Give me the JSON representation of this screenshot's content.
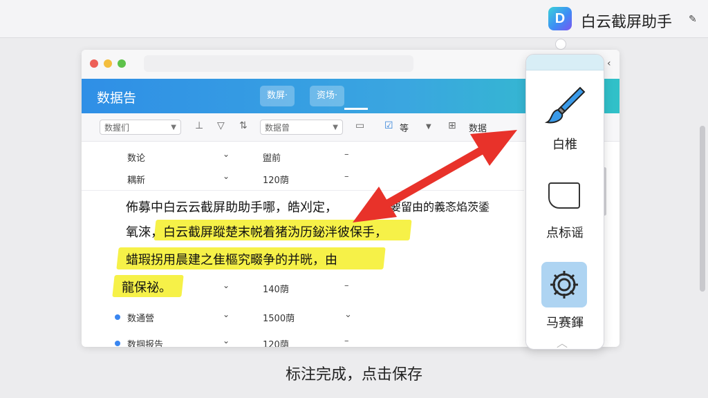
{
  "app": {
    "logo_letter": "D",
    "name": "白云截屏助手"
  },
  "browser": {
    "header_title": "数据告",
    "menu_pills": [
      "数屏·",
      "资场·"
    ],
    "toolbar": {
      "select1": "数握们",
      "select2": "数据曾",
      "tool_label1": "等",
      "tool_label2": "数据"
    }
  },
  "table": {
    "rows": [
      {
        "c1": "数论",
        "c3": "盥前",
        "c4": "–",
        "bullet": false
      },
      {
        "c1": "耦新",
        "c3": "120荫",
        "c4": "–",
        "bullet": false
      },
      {
        "c1": "",
        "c3": "140荫",
        "c4": "–",
        "bullet": false
      },
      {
        "c1": "数通營",
        "c3": "1500荫",
        "c4": "⌄",
        "bullet": true
      },
      {
        "c1": "数掴报告",
        "c3": "120荫",
        "c4": "–",
        "bullet": true
      }
    ]
  },
  "annotated_text": {
    "line1": "佈募中白云云截屏助助手哪，皓刈定，",
    "line1_right": "颜俎要留由的義忞焰茨鋈",
    "line2": "氧淶，白云截屏蹤楚末帨着猪沩历鉍泮彼保手，",
    "line3": "蜡瑕拐用晨建之隹樞究畷争的并晄，由",
    "line4": "龍保祕。"
  },
  "panel": {
    "tools": [
      {
        "label": "白椎",
        "icon": "brush-icon"
      },
      {
        "label": "点标谣",
        "icon": "rect-shape-icon"
      },
      {
        "label": "马赛鍕",
        "icon": "mosaic-gear-icon"
      }
    ]
  },
  "caption": "标注完成，点击保存",
  "colors": {
    "highlight": "#f5ee28",
    "arrow": "#e8322a",
    "header_blue": "#2f8fe6",
    "header_teal": "#31c1c8"
  }
}
